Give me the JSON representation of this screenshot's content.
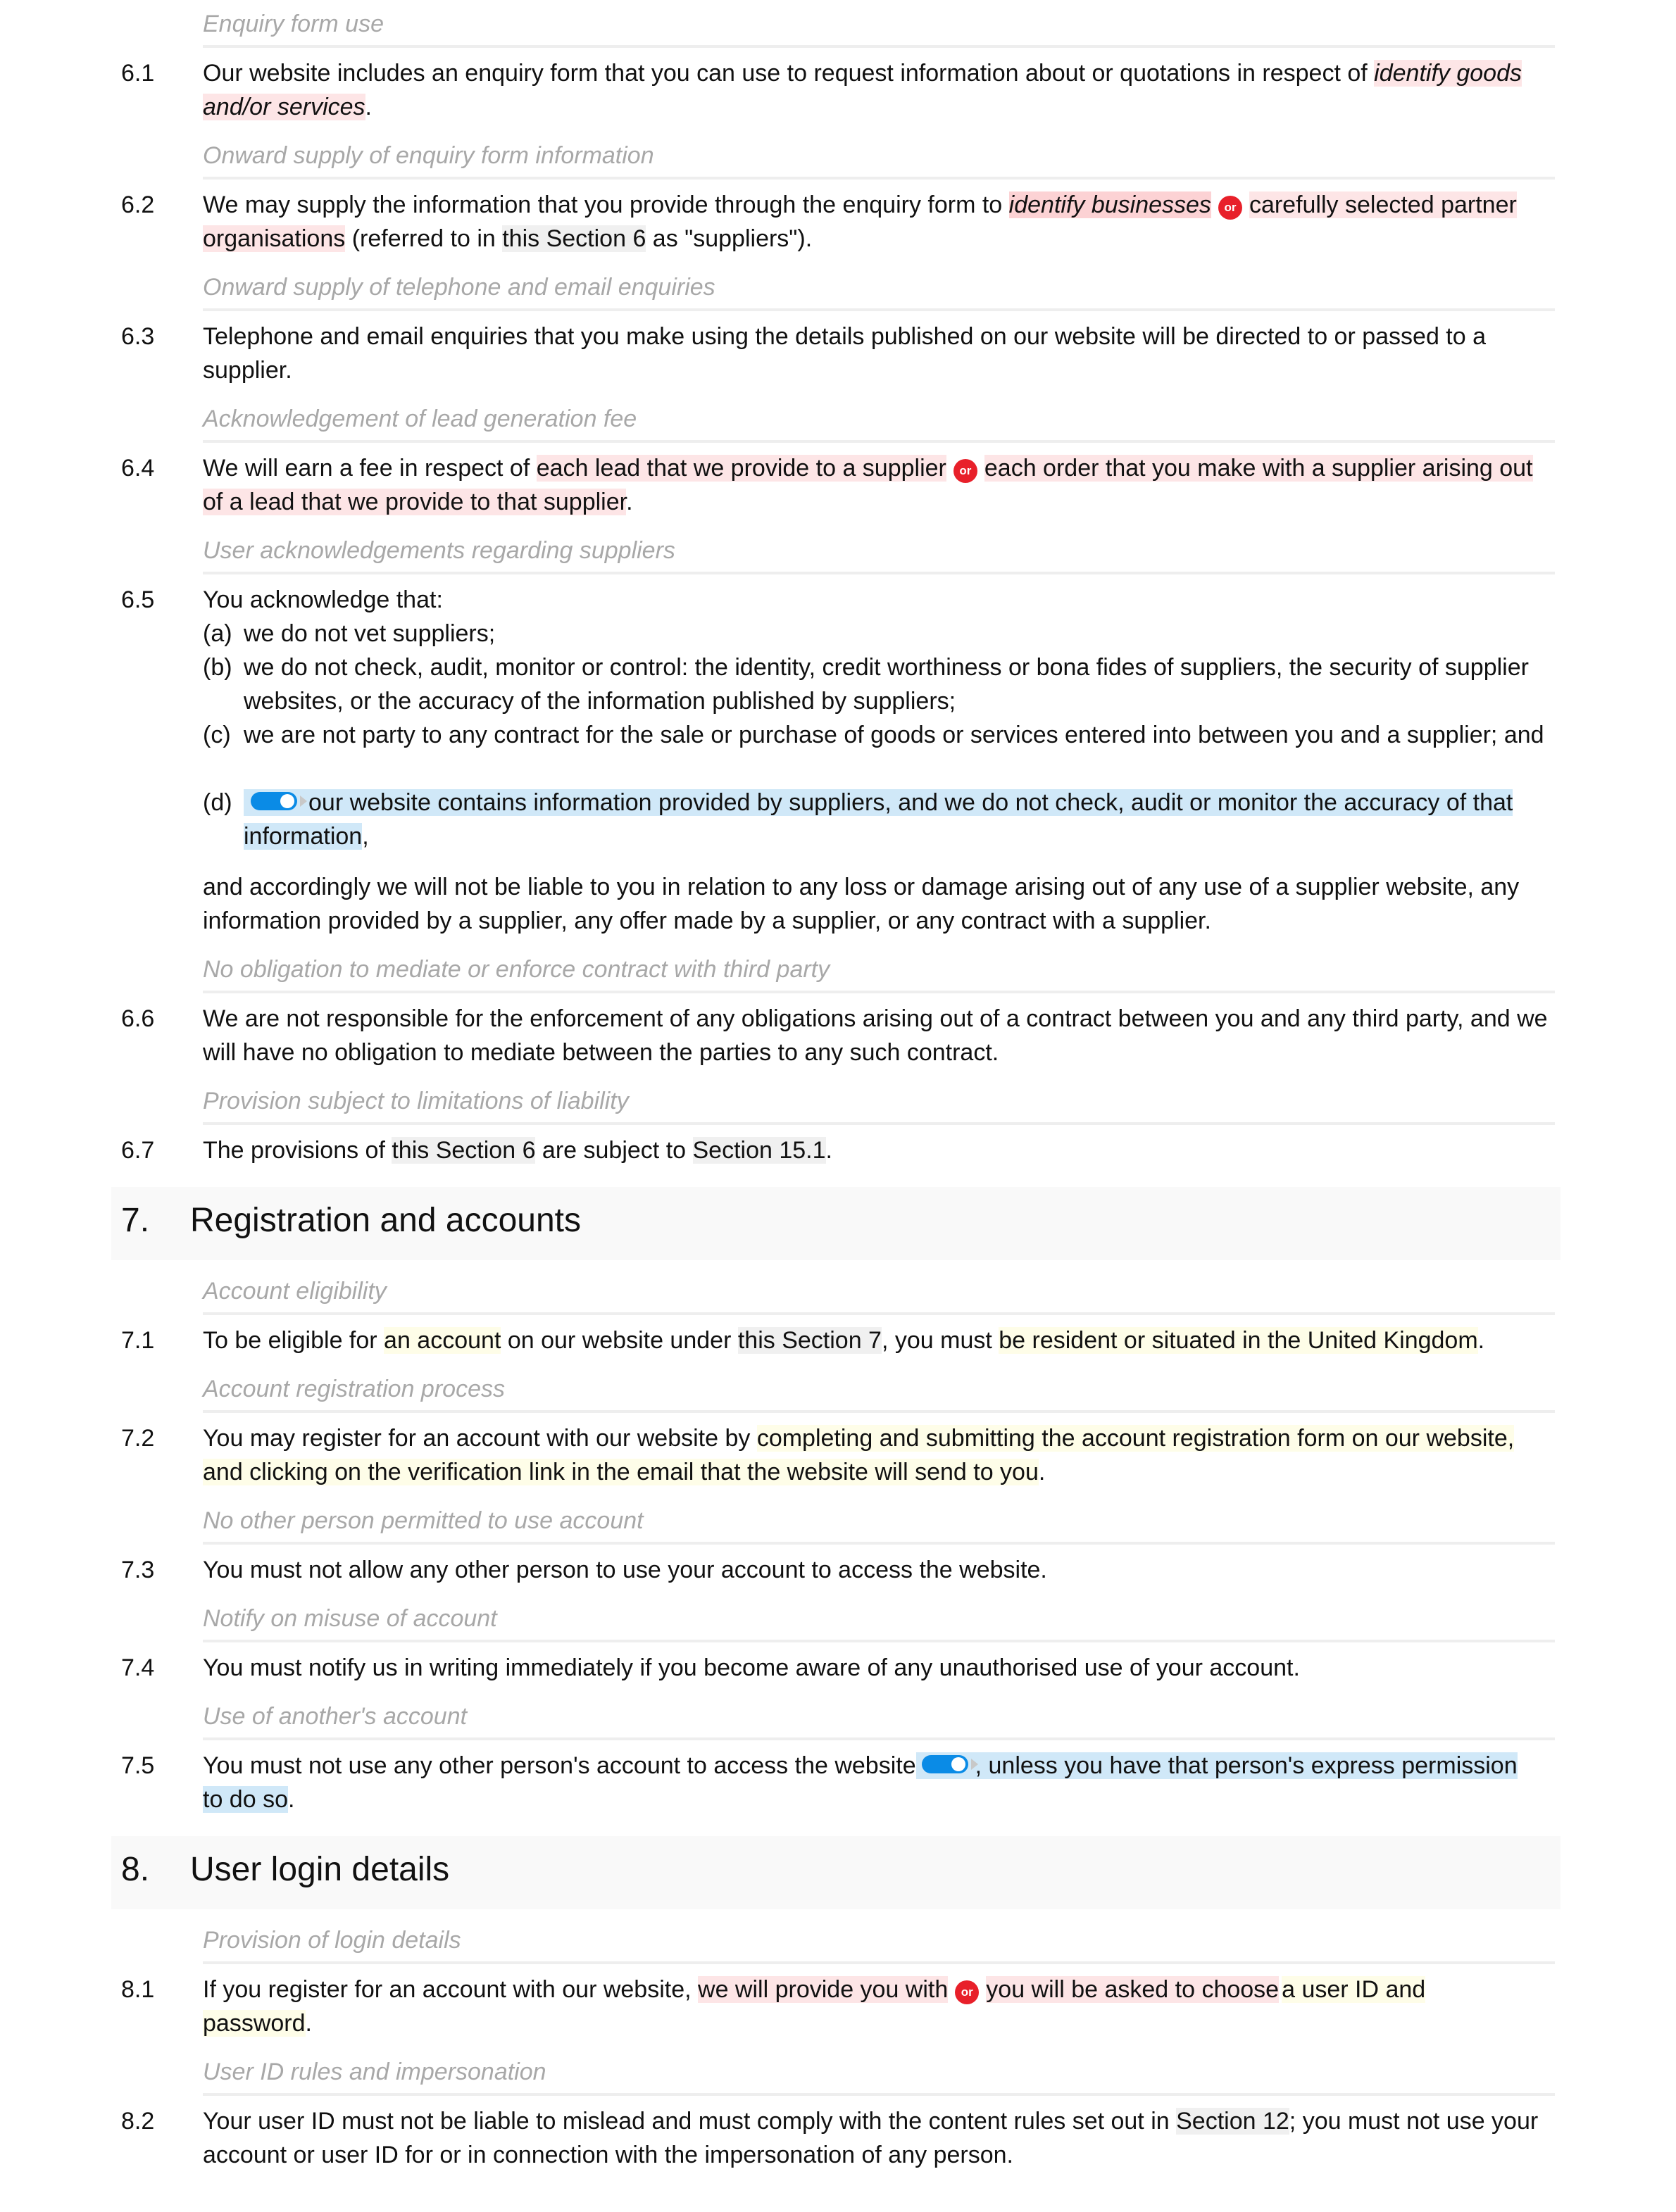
{
  "section6": {
    "c61": {
      "caption": "Enquiry form use",
      "num": "6.1",
      "t1": "Our website includes an enquiry form that you can use to request information about or quotations in respect of ",
      "hl1a": "identify goods",
      "hl1b": "and/or services",
      "t2": "."
    },
    "c62": {
      "caption": "Onward supply of enquiry form information",
      "num": "6.2",
      "t1": "We may supply the information that you provide through the enquiry form to ",
      "opt1": "identify businesses",
      "or": "or",
      "opt2a": "carefully selected partner",
      "opt2b": "organisations",
      "t2": " (referred to in ",
      "ref": "this Section 6",
      "t3": " as \"suppliers\")."
    },
    "c63": {
      "caption": "Onward supply of telephone and email enquiries",
      "num": "6.3",
      "t1": "Telephone and email enquiries that you make using the details published on our website will be directed to or passed to a",
      "t2": "supplier."
    },
    "c64": {
      "caption": "Acknowledgement of lead generation fee",
      "num": "6.4",
      "t1": "We will earn a fee in respect of ",
      "opt1": "each lead that we provide to a supplier",
      "or": "or",
      "opt2a": "each order that you make with a supplier arising out",
      "opt2b": "of a lead that we provide to that supplier",
      "t2": "."
    },
    "c65": {
      "caption": "User acknowledgements regarding suppliers",
      "num": "6.5",
      "intro": "You acknowledge that:",
      "items": [
        {
          "label": "(a)",
          "text": "we do not vet suppliers;"
        },
        {
          "label": "(b)",
          "text": "we do not check, audit, monitor or control: the identity, credit worthiness or bona fides of suppliers, the security of supplier websites, or the accuracy of the information published by suppliers;"
        },
        {
          "label": "(c)",
          "text": "we are not party to any contract for the sale or purchase of goods or services entered into between you and a supplier; and"
        },
        {
          "label": "(d)",
          "text_a": "our website contains information provided by suppliers, and we do not check, audit or monitor the accuracy of that",
          "text_b": "information",
          "tail": ",",
          "toggle_on": true
        }
      ],
      "outro": "and accordingly we will not be liable to you in relation to any loss or damage arising out of any use of a supplier website, any information provided by a supplier, any offer made by a supplier, or any contract with a supplier."
    },
    "c66": {
      "caption": "No obligation to mediate or enforce contract with third party",
      "num": "6.6",
      "text": "We are not responsible for the enforcement of any obligations arising out of a contract between you and any third party, and we will have no obligation to mediate between the parties to any such contract."
    },
    "c67": {
      "caption": "Provision subject to limitations of liability",
      "num": "6.7",
      "t1": "The provisions of ",
      "ref1": "this Section 6",
      "t2": " are subject to ",
      "ref2": "Section 15.1",
      "t3": "."
    }
  },
  "section7": {
    "num": "7.",
    "title": "Registration and accounts",
    "c71": {
      "caption": "Account eligibility",
      "num": "7.1",
      "t1": "To be eligible for ",
      "hl1": "an account",
      "t2": " on our website under ",
      "ref": "this Section 7",
      "t3": ", you must ",
      "hl2": "be resident or situated in the United Kingdom",
      "t4": "."
    },
    "c72": {
      "caption": "Account registration process",
      "num": "7.2",
      "t1": "You may register for an account with our website by ",
      "hl1a": "completing and submitting the account registration form on our website,",
      "hl1b": "and clicking on the verification link in the email that the website will send to you",
      "t2": "."
    },
    "c73": {
      "caption": "No other person permitted to use account",
      "num": "7.3",
      "text": "You must not allow any other person to use your account to access the website."
    },
    "c74": {
      "caption": "Notify on misuse of account",
      "num": "7.4",
      "text": "You must notify us in writing immediately if you become aware of any unauthorised use of your account."
    },
    "c75": {
      "caption": "Use of another's account",
      "num": "7.5",
      "t1": "You must not use any other person's account to access the website",
      "opt_a": ", unless you have that person's express permission",
      "opt_b": "to do so",
      "t2": ".",
      "toggle_on": true
    }
  },
  "section8": {
    "num": "8.",
    "title": "User login details",
    "c81": {
      "caption": "Provision of login details",
      "num": "8.1",
      "t1": "If you register for an account with our website, ",
      "opt1": "we will provide you with",
      "or": "or",
      "opt2": "you will be asked to choose",
      "hl_a": "a user ID and",
      "hl_b": "password",
      "t2": "."
    },
    "c82": {
      "caption": "User ID rules and impersonation",
      "num": "8.2",
      "t1": "Your user ID must not be liable to mislead and must comply with the content rules set out in ",
      "ref": "Section 12",
      "t2": "; you must not use your account or user ID for or in connection with the impersonation of any person."
    }
  },
  "colors": {
    "option_highlight": "#fde5e6",
    "selected_option_highlight": "#fcd2d4",
    "variable_highlight": "#fefde8",
    "optional_text_highlight": "#d0e8f8",
    "cross_reference_highlight": "#f0f0f0",
    "or_badge": "#e8202a",
    "toggle_on": "#0a8be6",
    "caption_text": "#a8a8a8"
  }
}
